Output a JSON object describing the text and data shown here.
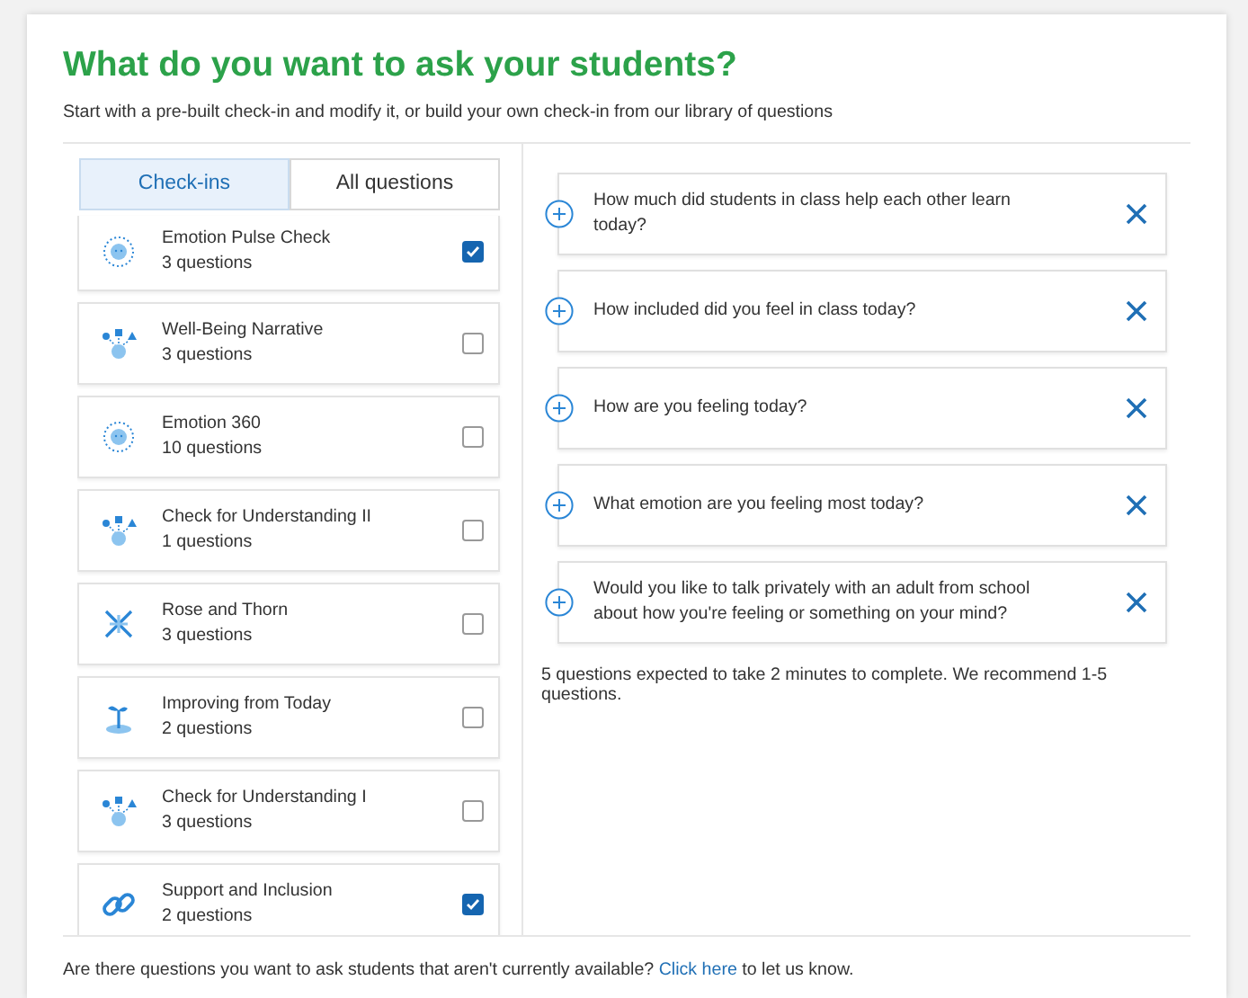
{
  "title": "What do you want to ask your students?",
  "subtitle": "Start with a pre-built check-in and modify it, or build your own check-in from our library of questions",
  "tabs": [
    {
      "label": "Check-ins",
      "selected": true
    },
    {
      "label": "All questions",
      "selected": false
    }
  ],
  "checkins": [
    {
      "name": "Emotion Pulse Check",
      "count": "3 questions",
      "checked": true
    },
    {
      "name": "Well-Being Narrative",
      "count": "3 questions",
      "checked": false
    },
    {
      "name": "Emotion 360",
      "count": "10 questions",
      "checked": false
    },
    {
      "name": "Check for Understanding II",
      "count": "1 questions",
      "checked": false
    },
    {
      "name": "Rose and Thorn",
      "count": "3 questions",
      "checked": false
    },
    {
      "name": "Improving from Today",
      "count": "2 questions",
      "checked": false
    },
    {
      "name": "Check for Understanding I",
      "count": "3 questions",
      "checked": false
    },
    {
      "name": "Support and Inclusion",
      "count": "2 questions",
      "checked": true
    }
  ],
  "questions": [
    "How much did students in class help each other learn today?",
    "How included did you feel in class today?",
    "How are you feeling today?",
    "What emotion are you feeling most today?",
    "Would you like to talk privately with an adult from school about how you're feeling or something on your mind?"
  ],
  "summary": "5 questions expected to take 2 minutes to complete. We recommend 1-5 questions.",
  "footer": {
    "before": "Are there questions you want to ask students that aren't currently available?",
    "link": "Click here",
    "after": "to let us know."
  }
}
